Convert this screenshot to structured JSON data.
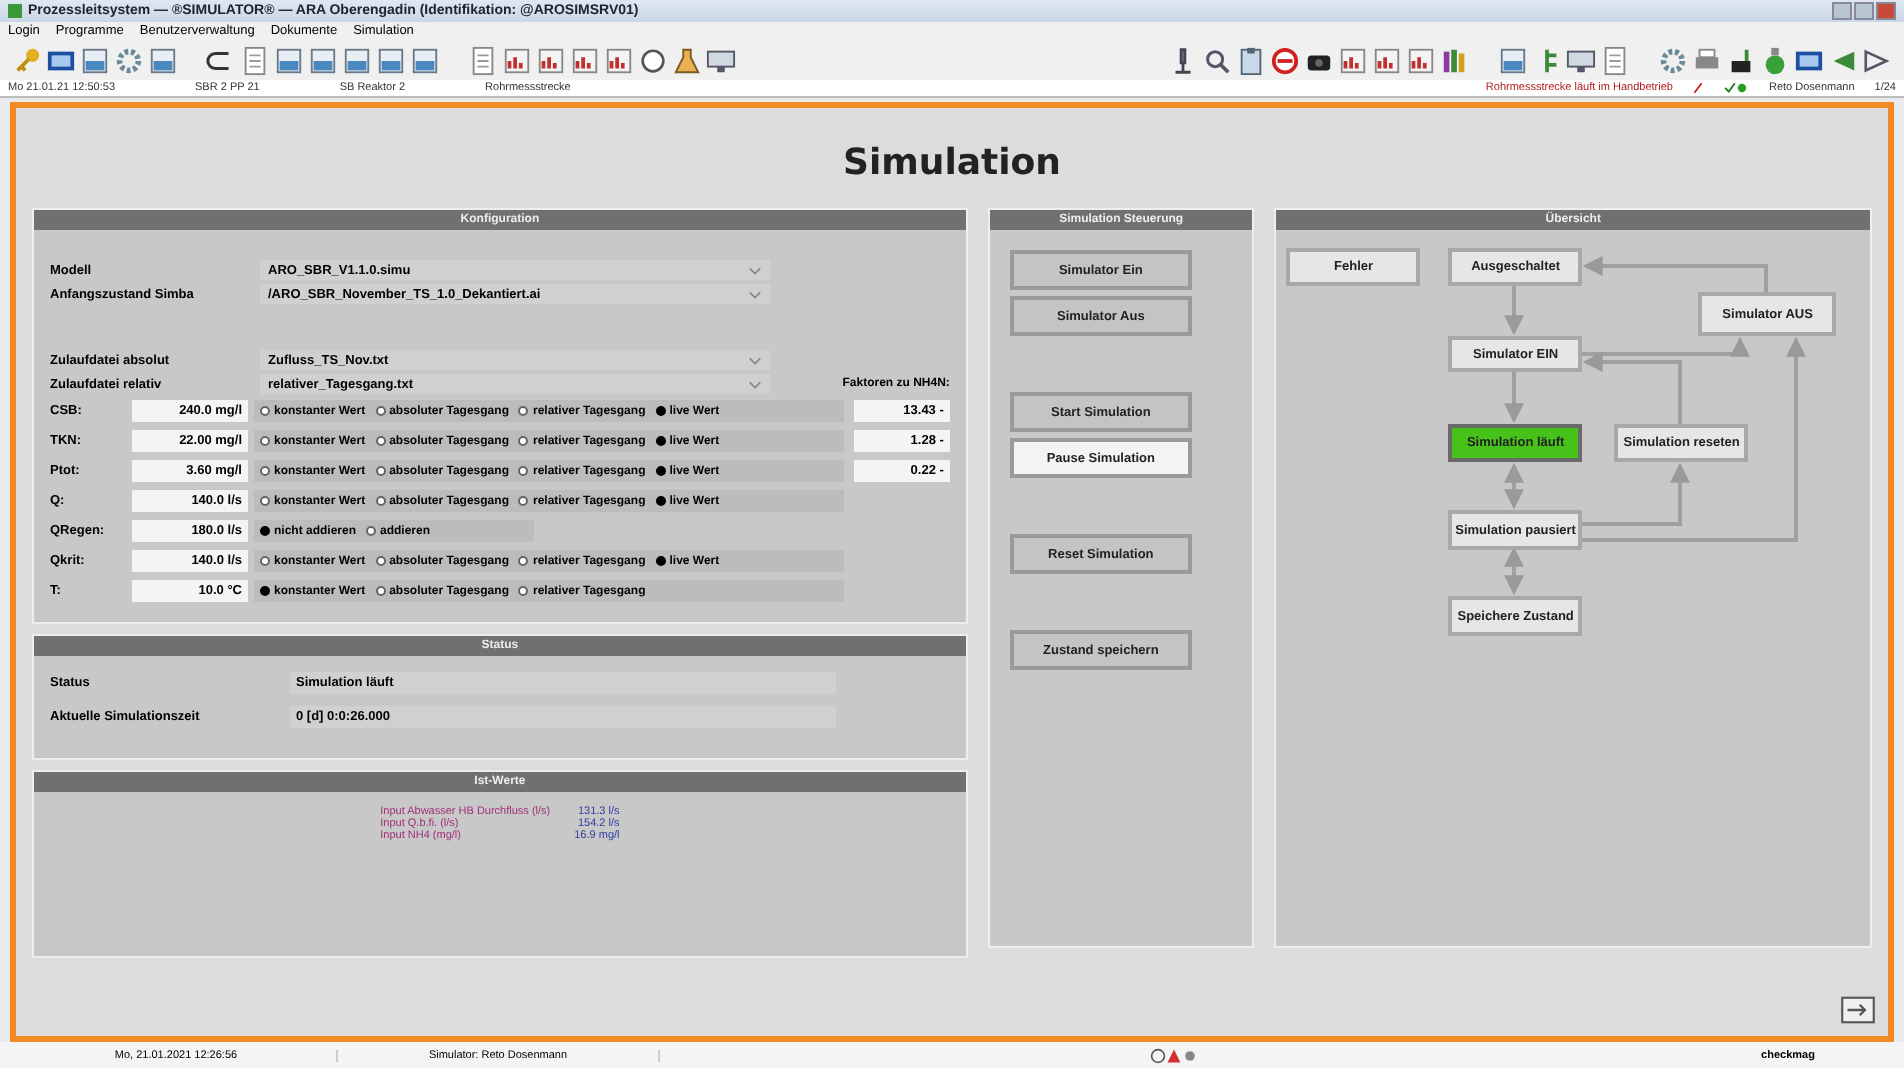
{
  "window": {
    "title": "Prozessleitsystem — ®SIMULATOR® — ARA Oberengadin (Identifikation: @AROSIMSRV01)"
  },
  "menu": [
    "Login",
    "Programme",
    "Benutzerverwaltung",
    "Dokumente",
    "Simulation"
  ],
  "info_bar": {
    "left": [
      "Mo 21.01.21 12:50:53",
      "SBR 2 PP 21",
      "SB Reaktor 2",
      "Rohrmessstrecke"
    ],
    "right": [
      "Rohrmessstrecke läuft im Handbetrieb",
      "Reto Dosenmann",
      "1/24"
    ]
  },
  "page_title": "Simulation",
  "konfiguration": {
    "title": "Konfiguration",
    "model_files": [
      {
        "label": "Modell",
        "value": "ARO_SBR_V1.1.0.simu"
      },
      {
        "label": "Anfangszustand Simba",
        "value": "/ARO_SBR_November_TS_1.0_Dekantiert.ai"
      }
    ],
    "inflow_files": [
      {
        "label": "Zulaufdatei absolut",
        "value": "Zufluss_TS_Nov.txt"
      },
      {
        "label": "Zulaufdatei relativ",
        "value": "relativer_Tagesgang.txt"
      }
    ],
    "factors_label": "Faktoren zu NH4N:",
    "params": [
      {
        "label": "CSB:",
        "value": "240.0 mg/l",
        "factor": "13.43 -",
        "options": [
          {
            "label": "konstanter Wert",
            "selected": false
          },
          {
            "label": "absoluter Tagesgang",
            "selected": false
          },
          {
            "label": "relativer Tagesgang",
            "selected": false
          },
          {
            "label": "live Wert",
            "selected": true
          }
        ]
      },
      {
        "label": "TKN:",
        "value": "22.00 mg/l",
        "factor": "1.28 -",
        "options": [
          {
            "label": "konstanter Wert",
            "selected": false
          },
          {
            "label": "absoluter Tagesgang",
            "selected": false
          },
          {
            "label": "relativer Tagesgang",
            "selected": false
          },
          {
            "label": "live Wert",
            "selected": true
          }
        ]
      },
      {
        "label": "Ptot:",
        "value": "3.60 mg/l",
        "factor": "0.22 -",
        "options": [
          {
            "label": "konstanter Wert",
            "selected": false
          },
          {
            "label": "absoluter Tagesgang",
            "selected": false
          },
          {
            "label": "relativer Tagesgang",
            "selected": false
          },
          {
            "label": "live Wert",
            "selected": true
          }
        ]
      },
      {
        "label": "Q:",
        "value": "140.0 l/s",
        "options": [
          {
            "label": "konstanter Wert",
            "selected": false
          },
          {
            "label": "absoluter Tagesgang",
            "selected": false
          },
          {
            "label": "relativer Tagesgang",
            "selected": false
          },
          {
            "label": "live Wert",
            "selected": true
          }
        ]
      },
      {
        "label": "QRegen:",
        "value": "180.0 l/s",
        "options": [
          {
            "label": "nicht addieren",
            "selected": true
          },
          {
            "label": "addieren",
            "selected": false
          }
        ]
      },
      {
        "label": "Qkrit:",
        "value": "140.0 l/s",
        "options": [
          {
            "label": "konstanter Wert",
            "selected": false
          },
          {
            "label": "absoluter Tagesgang",
            "selected": false
          },
          {
            "label": "relativer Tagesgang",
            "selected": false
          },
          {
            "label": "live Wert",
            "selected": true
          }
        ]
      },
      {
        "label": "T:",
        "value": "10.0 °C",
        "options": [
          {
            "label": "konstanter Wert",
            "selected": true
          },
          {
            "label": "absoluter Tagesgang",
            "selected": false
          },
          {
            "label": "relativer Tagesgang",
            "selected": false
          }
        ]
      }
    ]
  },
  "status": {
    "title": "Status",
    "rows": [
      {
        "label": "Status",
        "value": "Simulation läuft"
      },
      {
        "label": "Aktuelle Simulationszeit",
        "value": "0 [d] 0:0:26.000"
      }
    ]
  },
  "ist_werte": {
    "title": "Ist-Werte",
    "rows": [
      {
        "label": "Input Abwasser HB Durchfluss (l/s)",
        "value": "131.3 l/s"
      },
      {
        "label": "Input Q.b.fi. (l/s)",
        "value": "154.2 l/s"
      },
      {
        "label": "Input NH4 (mg/l)",
        "value": "16.9 mg/l"
      }
    ]
  },
  "steuerung": {
    "title": "Simulation Steuerung",
    "button_groups": [
      [
        {
          "label": "Simulator Ein",
          "selected": false
        },
        {
          "label": "Simulator Aus",
          "selected": false
        }
      ],
      [
        {
          "label": "Start Simulation",
          "selected": false
        },
        {
          "label": "Pause Simulation",
          "selected": true
        }
      ],
      [
        {
          "label": "Reset Simulation",
          "selected": false
        }
      ],
      [
        {
          "label": "Zustand speichern",
          "selected": false
        }
      ]
    ]
  },
  "uebersicht": {
    "title": "Übersicht",
    "nodes": [
      {
        "label": "Fehler",
        "active": false
      },
      {
        "label": "Ausgeschaltet",
        "active": false
      },
      {
        "label": "Simulator AUS",
        "active": false
      },
      {
        "label": "Simulator EIN",
        "active": false
      },
      {
        "label": "Simulation läuft",
        "active": true
      },
      {
        "label": "Simulation reseten",
        "active": false
      },
      {
        "label": "Simulation pausiert",
        "active": false
      },
      {
        "label": "Speichere Zustand",
        "active": false
      }
    ]
  },
  "footer": {
    "datetime": "Mo, 21.01.2021 12:26:56",
    "user": "Simulator: Reto Dosenmann",
    "brand": "checkmag"
  }
}
